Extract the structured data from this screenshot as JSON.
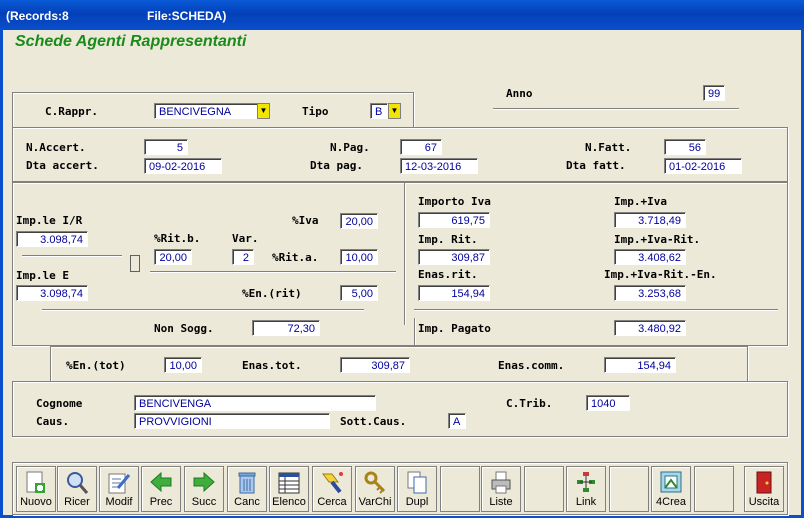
{
  "window": {
    "records": "(Records:8",
    "file": "File:SCHEDA)"
  },
  "form_title": "Schede Agenti Rappresentanti",
  "header": {
    "anno_label": "Anno",
    "anno_value": "99",
    "crappr_label": "C.Rappr.",
    "crappr_value": "BENCIVEGNA",
    "tipo_label": "Tipo",
    "tipo_value": "B"
  },
  "accert": {
    "n_accert_label": "N.Accert.",
    "n_accert_value": "5",
    "dta_accert_label": "Dta accert.",
    "dta_accert_value": "09-02-2016",
    "n_pag_label": "N.Pag.",
    "n_pag_value": "67",
    "dta_pag_label": "Dta pag.",
    "dta_pag_value": "12-03-2016",
    "n_fatt_label": "N.Fatt.",
    "n_fatt_value": "56",
    "dta_fatt_label": "Dta fatt.",
    "dta_fatt_value": "01-02-2016"
  },
  "calc": {
    "imple_ir_label": "Imp.le I/R",
    "imple_ir_value": "3.098,74",
    "iva_pct_label": "%Iva",
    "iva_pct_value": "20,00",
    "ritb_label": "%Rit.b.",
    "ritb_value": "20,00",
    "var_label": "Var.",
    "var_value": "2",
    "rita_label": "%Rit.a.",
    "rita_value": "10,00",
    "imple_e_label": "Imp.le E",
    "imple_e_value": "3.098,74",
    "enrit_label": "%En.(rit)",
    "enrit_value": "5,00",
    "nonsogg_label": "Non Sogg.",
    "nonsogg_value": "72,30",
    "importo_iva_label": "Importo Iva",
    "importo_iva_value": "619,75",
    "imp_iva_label": "Imp.+Iva",
    "imp_iva_value": "3.718,49",
    "imp_rit_label": "Imp. Rit.",
    "imp_rit_value": "309,87",
    "imp_iva_rit_label": "Imp.+Iva-Rit.",
    "imp_iva_rit_value": "3.408,62",
    "enas_rit_label": "Enas.rit.",
    "enas_rit_value": "154,94",
    "imp_iva_rit_en_label": "Imp.+Iva-Rit.-En.",
    "imp_iva_rit_en_value": "3.253,68",
    "imp_pagato_label": "Imp. Pagato",
    "imp_pagato_value": "3.480,92"
  },
  "totals": {
    "en_tot_label": "%En.(tot)",
    "en_tot_value": "10,00",
    "enas_tot_label": "Enas.tot.",
    "enas_tot_value": "309,87",
    "enas_comm_label": "Enas.comm.",
    "enas_comm_value": "154,94"
  },
  "anagrafica": {
    "cognome_label": "Cognome",
    "cognome_value": "BENCIVENGA",
    "ctrib_label": "C.Trib.",
    "ctrib_value": "1040",
    "caus_label": "Caus.",
    "caus_value": "PROVVIGIONI",
    "sott_caus_label": "Sott.Caus.",
    "sott_caus_value": "A"
  },
  "toolbar": {
    "nuovo": "Nuovo",
    "ricer": "Ricer",
    "modif": "Modif",
    "prec": "Prec",
    "succ": "Succ",
    "canc": "Canc",
    "elenco": "Elenco",
    "cerca": "Cerca",
    "varchi": "VarChi",
    "dupl": "Dupl",
    "liste": "Liste",
    "link": "Link",
    "crea": "4Crea",
    "uscita": "Uscita"
  },
  "colors": {
    "title_bar": "#0a4fcb",
    "form_title": "#1a8a1a",
    "field_text": "#00009c",
    "dropdown_button": "#f2e600"
  }
}
